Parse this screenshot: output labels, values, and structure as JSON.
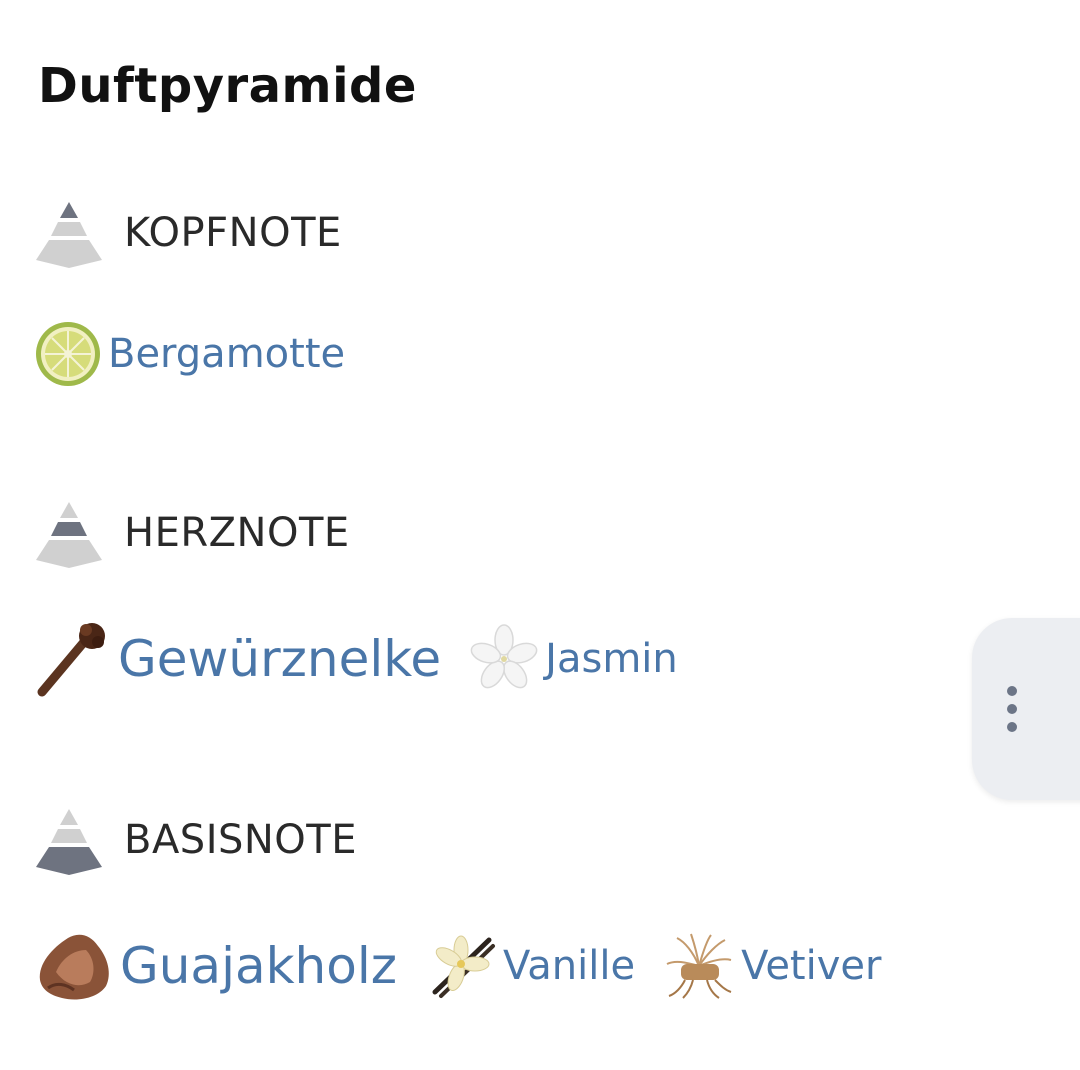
{
  "title": "Duftpyramide",
  "sections": [
    {
      "label": "KOPFNOTE",
      "level": "top",
      "notes": [
        {
          "label": "Bergamotte",
          "icon": "bergamot-icon",
          "size": "mid"
        }
      ]
    },
    {
      "label": "HERZNOTE",
      "level": "middle",
      "notes": [
        {
          "label": "Gewürznelke",
          "icon": "clove-icon",
          "size": "big"
        },
        {
          "label": "Jasmin",
          "icon": "jasmine-icon",
          "size": "mid"
        }
      ]
    },
    {
      "label": "BASISNOTE",
      "level": "base",
      "notes": [
        {
          "label": "Guajakholz",
          "icon": "guaiac-wood-icon",
          "size": "big"
        },
        {
          "label": "Vanille",
          "icon": "vanilla-icon",
          "size": "mid"
        },
        {
          "label": "Vetiver",
          "icon": "vetiver-icon",
          "size": "mid"
        }
      ]
    }
  ],
  "more_menu": {
    "icon": "more-vertical-icon"
  },
  "colors": {
    "note_link": "#4a76a8",
    "pyramid_active": "#6e7380",
    "pyramid_inactive": "#d0d0d0",
    "fab_background": "#eceef2"
  }
}
